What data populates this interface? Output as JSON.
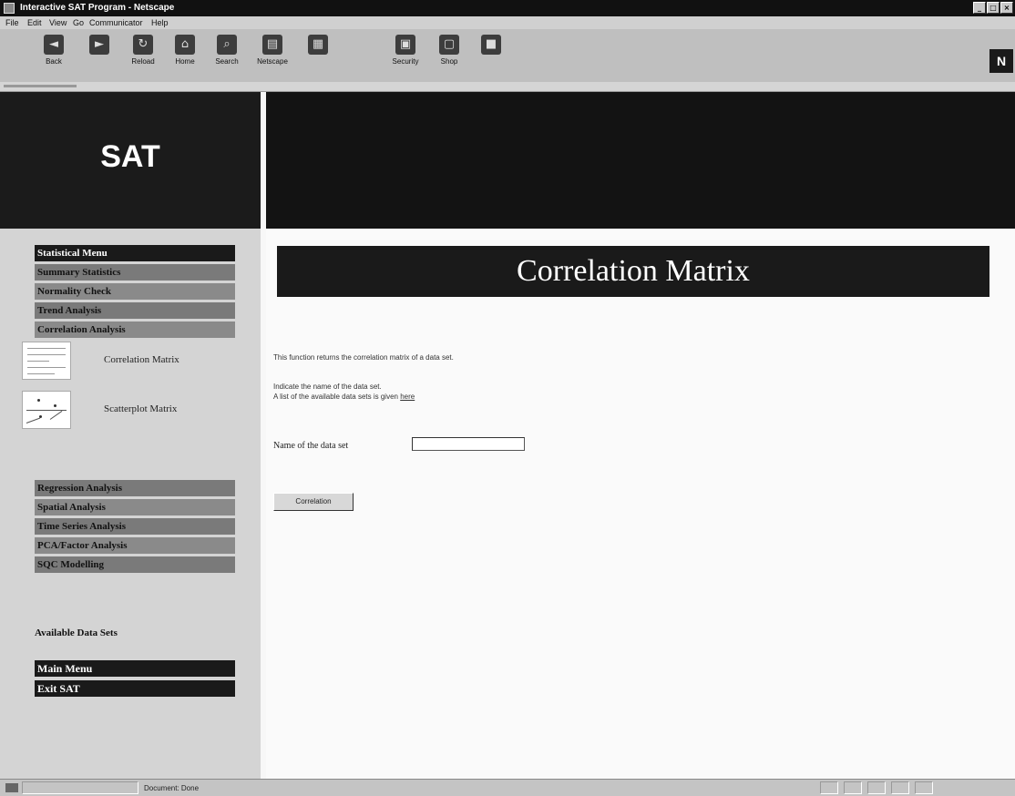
{
  "window": {
    "title": "Interactive SAT Program - Netscape"
  },
  "menu": [
    "File",
    "Edit",
    "View",
    "Go",
    "Communicator",
    "Help"
  ],
  "toolbar": [
    {
      "label": "Back",
      "icon": "back-arrow-icon"
    },
    {
      "label": "",
      "icon": "forward-arrow-icon"
    },
    {
      "label": "Reload",
      "icon": "reload-icon"
    },
    {
      "label": "Home",
      "icon": "home-icon"
    },
    {
      "label": "Search",
      "icon": "search-icon"
    },
    {
      "label": "Netscape",
      "icon": "netscape-icon"
    },
    {
      "label": "",
      "icon": "print-icon"
    },
    {
      "label": "Security",
      "icon": "lock-icon"
    },
    {
      "label": "Shop",
      "icon": "shop-icon"
    },
    {
      "label": "",
      "icon": "stop-icon"
    }
  ],
  "throbber": "N",
  "logo": "SAT",
  "sidebar": {
    "statistical_menu": "Statistical Menu",
    "items": [
      "Summary Statistics",
      "Normality Check",
      "Trend Analysis",
      "Correlation Analysis"
    ],
    "sub_items": [
      "Correlation Matrix",
      "Scatterplot Matrix"
    ],
    "items2": [
      "Regression Analysis",
      "Spatial Analysis",
      "Time Series Analysis",
      "PCA/Factor Analysis",
      "SQC Modelling"
    ],
    "available": "Available Data Sets",
    "main_menu": "Main Menu",
    "exit": "Exit SAT"
  },
  "main": {
    "title": "Correlation Matrix",
    "desc": "This function returns the correlation matrix of a data set.",
    "indicate": "Indicate the name of the data set.",
    "list_prefix": "A list of the available data sets is given",
    "list_link": "here",
    "field_label": "Name of the data set",
    "field_value": "",
    "button": "Correlation"
  },
  "status": {
    "text": "Document: Done"
  }
}
